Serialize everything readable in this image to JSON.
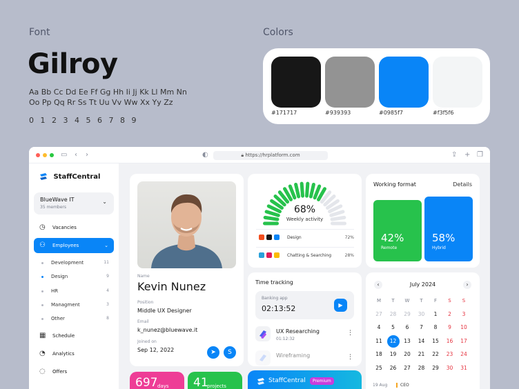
{
  "style_guide": {
    "font_label": "Font",
    "font_name": "Gilroy",
    "alphabet": "Aa Bb Cc Dd Ee Ff Gg Hh Ii Jj Kk Ll Mm Nn Oo Pp Qq Rr Ss Tt Uu Vv Ww Xx Yy Zz",
    "digits": "0 1 2 3 4 5 6 7 8 9",
    "colors_label": "Colors",
    "swatches": [
      {
        "hex": "#171717",
        "label": "#171717"
      },
      {
        "hex": "#939393",
        "label": "#939393"
      },
      {
        "hex": "#0985f7",
        "label": "#0985f7"
      },
      {
        "hex": "#f3f5f6",
        "label": "#f3f5f6"
      }
    ]
  },
  "browser": {
    "url": "https://hrplatform.com"
  },
  "sidebar": {
    "brand": "StaffCentral",
    "org_name": "BlueWave IT",
    "org_members": "35 members",
    "nav": [
      {
        "label": "Vacancies",
        "icon": "clock-icon"
      },
      {
        "label": "Employees",
        "icon": "users-icon",
        "active": true
      }
    ],
    "sub_items": [
      {
        "label": "Development",
        "count": "11"
      },
      {
        "label": "Design",
        "count": "9",
        "active": true
      },
      {
        "label": "HR",
        "count": "4"
      },
      {
        "label": "Managment",
        "count": "3"
      },
      {
        "label": "Other",
        "count": "8"
      }
    ],
    "nav_bottom": [
      {
        "label": "Schedule",
        "icon": "calendar-icon"
      },
      {
        "label": "Analytics",
        "icon": "pie-chart-icon"
      },
      {
        "label": "Offers",
        "icon": "tag-icon"
      }
    ]
  },
  "profile": {
    "name_label": "Name",
    "name": "Kevin Nunez",
    "position_label": "Position",
    "position": "Middle UX Designer",
    "email_label": "Email",
    "email": "k_nunez@bluewave.it",
    "joined_label": "Joined on",
    "joined": "Sep 12, 2022"
  },
  "weekly_activity": {
    "percent": "68%",
    "percent_value": 68,
    "label": "Weekly activity",
    "rows": [
      {
        "name": "Design",
        "percent": "72%"
      },
      {
        "name": "Chatting & Searching",
        "percent": "28%"
      }
    ]
  },
  "working_format": {
    "title": "Working format",
    "details": "Details",
    "remote_pct": "42%",
    "remote_label": "Remote",
    "hybrid_pct": "58%",
    "hybrid_label": "Hybrid",
    "colors": {
      "remote": "#27c24c",
      "hybrid": "#0985f7"
    }
  },
  "time_tracking": {
    "title": "Time tracking",
    "app_name": "Banking app",
    "app_time": "02:13:52",
    "tasks": [
      {
        "name": "UX Researching",
        "time": "01:12:32"
      },
      {
        "name": "Wireframing",
        "time": ""
      }
    ]
  },
  "calendar": {
    "month": "July 2024",
    "weekdays": [
      "M",
      "T",
      "W",
      "T",
      "F",
      "S",
      "S"
    ],
    "weeks": [
      [
        "27",
        "28",
        "29",
        "30",
        "1",
        "2",
        "3"
      ],
      [
        "4",
        "5",
        "6",
        "7",
        "8",
        "9",
        "10"
      ],
      [
        "11",
        "12",
        "13",
        "14",
        "15",
        "16",
        "17"
      ],
      [
        "18",
        "19",
        "20",
        "21",
        "22",
        "23",
        "24"
      ],
      [
        "25",
        "26",
        "27",
        "28",
        "29",
        "30",
        "31"
      ]
    ],
    "today": "12"
  },
  "tiles": {
    "days_num": "697",
    "days_unit": "days",
    "projects_num": "41",
    "projects_unit": "projects",
    "promo_name": "StaffCentral",
    "promo_badge": "Premium",
    "sched_date": "19 Aug",
    "sched_event": "CEO"
  }
}
